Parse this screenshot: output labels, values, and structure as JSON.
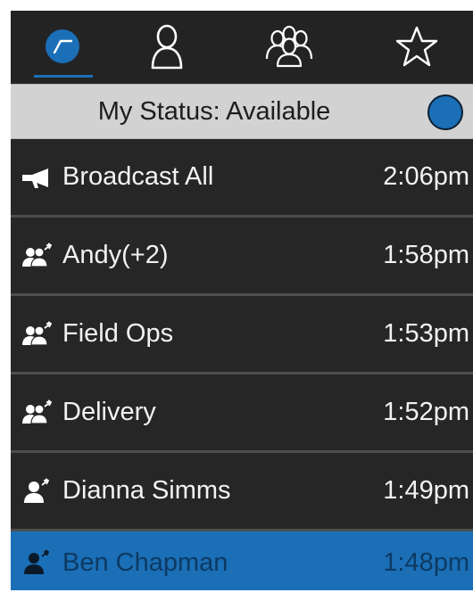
{
  "tabs": [
    {
      "id": "recent",
      "icon": "recent-calls-icon",
      "selected": true
    },
    {
      "id": "contacts",
      "icon": "person-icon",
      "selected": false
    },
    {
      "id": "groups",
      "icon": "group-icon",
      "selected": false
    },
    {
      "id": "favorites",
      "icon": "star-icon",
      "selected": false
    }
  ],
  "status": {
    "label": "My Status: Available",
    "indicator_color": "#1b6fb6"
  },
  "colors": {
    "accent": "#1b6fb6",
    "background": "#262626",
    "status_bar": "#d2d2d2"
  },
  "rows": [
    {
      "icon": "broadcast-megaphone-icon",
      "name": "Broadcast All",
      "time": "2:06pm",
      "selected": false
    },
    {
      "icon": "group-talk-icon",
      "name": "Andy(+2)",
      "time": "1:58pm",
      "selected": false
    },
    {
      "icon": "group-talk-icon",
      "name": "Field Ops",
      "time": "1:53pm",
      "selected": false
    },
    {
      "icon": "group-talk-icon",
      "name": "Delivery",
      "time": "1:52pm",
      "selected": false
    },
    {
      "icon": "private-talk-icon",
      "name": "Dianna Simms",
      "time": "1:49pm",
      "selected": false
    },
    {
      "icon": "private-talk-icon",
      "name": "Ben Chapman",
      "time": "1:48pm",
      "selected": true
    }
  ]
}
